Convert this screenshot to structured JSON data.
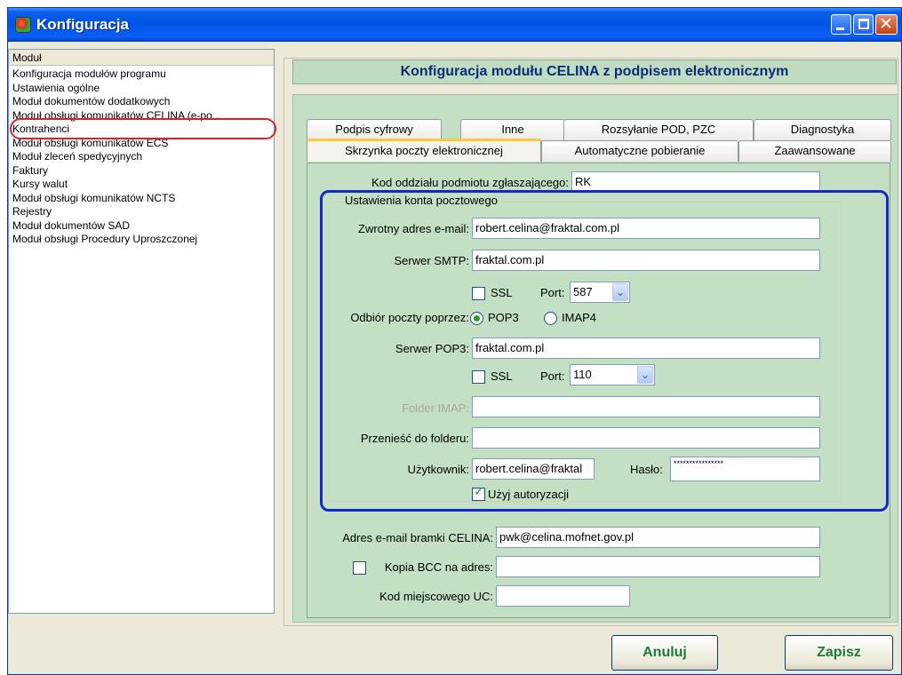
{
  "window": {
    "title": "Konfiguracja"
  },
  "sidebar": {
    "header": "Moduł",
    "items": [
      "Konfiguracja modułów programu",
      "Ustawienia ogólne",
      "Moduł dokumentów dodatkowych",
      "Moduł obsługi komunikatów CELINA (e-po...",
      "Kontrahenci",
      "Moduł obsługi komunikatów ECS",
      "Moduł zleceń spedycyjnych",
      "Faktury",
      "Kursy walut",
      "Moduł obsługi komunikatów NCTS",
      "Rejestry",
      "Moduł dokumentów SAD",
      "Moduł obsługi Procedury Uproszczonej"
    ]
  },
  "panel": {
    "header": "Konfiguracja modułu CELINA z podpisem elektronicznym"
  },
  "tabs": {
    "back_row": [
      "Podpis cyfrowy",
      "Inne",
      "Rozsyłanie POD, PZC",
      "Diagnostyka"
    ],
    "front_row": [
      "Skrzynka poczty elektronicznej",
      "Automatyczne pobieranie",
      "Zaawansowane"
    ],
    "active": "Skrzynka poczty elektronicznej"
  },
  "form": {
    "kod_oddzialu_label": "Kod oddziału podmiotu zgłaszającego:",
    "kod_oddzialu_value": "RK",
    "group_title": "Ustawienia konta pocztowego",
    "zwrotny_label": "Zwrotny adres e-mail:",
    "zwrotny_value": "robert.celina@fraktal.com.pl",
    "smtp_label": "Serwer SMTP:",
    "smtp_value": "fraktal.com.pl",
    "smtp_ssl_label": "SSL",
    "smtp_ssl_checked": false,
    "smtp_port_label": "Port:",
    "smtp_port_value": "587",
    "odbior_label": "Odbiór poczty poprzez:",
    "pop3_label": "POP3",
    "imap4_label": "IMAP4",
    "protocol_selected": "POP3",
    "pop3_server_label": "Serwer POP3:",
    "pop3_server_value": "fraktal.com.pl",
    "pop3_ssl_label": "SSL",
    "pop3_ssl_checked": false,
    "pop3_port_label": "Port:",
    "pop3_port_value": "110",
    "folder_imap_label": "Folder IMAP:",
    "folder_imap_value": "",
    "przenies_label": "Przenieść do folderu:",
    "przenies_value": "",
    "uzytkownik_label": "Użytkownik:",
    "uzytkownik_value": "robert.celina@fraktal",
    "haslo_label": "Hasło:",
    "haslo_value": "****************",
    "autoryzacja_label": "Użyj autoryzacji",
    "autoryzacja_checked": true,
    "bramka_label": "Adres e-mail bramki CELINA:",
    "bramka_value": "pwk@celina.mofnet.gov.pl",
    "kopia_bcc_label": "Kopia BCC na adres:",
    "kopia_bcc_checked": false,
    "kopia_bcc_value": "",
    "kod_uc_label": "Kod miejscowego UC:",
    "kod_uc_value": ""
  },
  "buttons": {
    "cancel": "Anuluj",
    "save": "Zapisz"
  },
  "colors": {
    "title_bar": "#0054e3",
    "header_band": "#bfdcc0",
    "tab_page": "#c3dfc4",
    "button_text": "#1a7c3a",
    "highlight_circle": "#e0202a",
    "highlight_box": "#1428c8"
  },
  "icons": {
    "app": "app-logo-icon",
    "minimize": "minimize-icon",
    "maximize": "maximize-icon",
    "close": "close-icon",
    "dropdown": "chevron-down-icon",
    "check": "check-icon"
  }
}
